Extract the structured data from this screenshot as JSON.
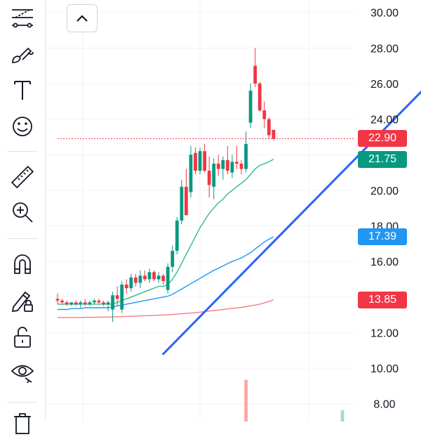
{
  "toolbar": {
    "tools": [
      {
        "icon": "trend-line-tools-icon"
      },
      {
        "icon": "brush-icon"
      },
      {
        "icon": "text-tool-icon"
      },
      {
        "icon": "emoji-icon"
      },
      {
        "icon": "ruler-icon"
      },
      {
        "icon": "zoom-in-icon"
      },
      {
        "icon": "magnet-icon"
      },
      {
        "icon": "lock-drawing-icon"
      },
      {
        "icon": "unlock-icon"
      },
      {
        "icon": "eye-icon"
      },
      {
        "icon": "trash-icon"
      }
    ]
  },
  "chart_data": {
    "type": "candlestick",
    "y_axis": {
      "ticks": [
        "30.00",
        "28.00",
        "26.00",
        "24.00",
        "22.00",
        "20.00",
        "18.00",
        "16.00",
        "14.00",
        "12.00",
        "10.00",
        "8.00"
      ],
      "tick_values": [
        30,
        28,
        26,
        24,
        22,
        20,
        18,
        16,
        14,
        12,
        10,
        8
      ],
      "range": [
        7.0,
        30.7
      ]
    },
    "price_tags": [
      {
        "label": "22.90",
        "value": 22.9,
        "color": "#f23645"
      },
      {
        "label": "21.75",
        "value": 21.75,
        "color": "#089981"
      },
      {
        "label": "17.39",
        "value": 17.39,
        "color": "#2196f3"
      },
      {
        "label": "13.85",
        "value": 13.85,
        "color": "#f23645"
      }
    ],
    "candles": [
      [
        13.9,
        14.2,
        13.6,
        13.8
      ],
      [
        13.8,
        13.9,
        13.6,
        13.7
      ],
      [
        13.7,
        13.8,
        13.5,
        13.6
      ],
      [
        13.6,
        13.7,
        13.5,
        13.7
      ],
      [
        13.7,
        13.8,
        13.5,
        13.6
      ],
      [
        13.6,
        13.8,
        13.4,
        13.7
      ],
      [
        13.7,
        13.9,
        13.5,
        13.6
      ],
      [
        13.6,
        13.8,
        13.5,
        13.7
      ],
      [
        13.7,
        13.9,
        13.6,
        13.8
      ],
      [
        13.8,
        13.9,
        13.6,
        13.7
      ],
      [
        13.7,
        13.8,
        13.5,
        13.6
      ],
      [
        13.6,
        13.8,
        13.2,
        13.7
      ],
      [
        13.3,
        14.3,
        12.6,
        14.1
      ],
      [
        14.1,
        14.6,
        13.5,
        13.9
      ],
      [
        13.3,
        14.9,
        13.1,
        14.7
      ],
      [
        14.7,
        15.0,
        14.2,
        14.5
      ],
      [
        14.5,
        15.3,
        14.3,
        15.1
      ],
      [
        15.1,
        15.3,
        14.6,
        14.8
      ],
      [
        14.8,
        15.5,
        14.5,
        15.2
      ],
      [
        15.2,
        15.5,
        14.9,
        15.0
      ],
      [
        15.0,
        15.6,
        14.8,
        15.4
      ],
      [
        15.4,
        15.5,
        14.9,
        15.0
      ],
      [
        15.0,
        15.4,
        14.8,
        15.2
      ],
      [
        15.2,
        15.3,
        14.7,
        14.9
      ],
      [
        14.4,
        15.9,
        14.2,
        15.7
      ],
      [
        15.7,
        16.9,
        15.4,
        16.6
      ],
      [
        16.6,
        18.5,
        16.4,
        18.3
      ],
      [
        18.3,
        20.6,
        18.1,
        20.2
      ],
      [
        20.2,
        21.2,
        18.6,
        18.6
      ],
      [
        19.9,
        22.5,
        19.6,
        22.0
      ],
      [
        22.1,
        22.4,
        20.9,
        21.1
      ],
      [
        21.1,
        22.4,
        20.9,
        22.2
      ],
      [
        22.2,
        22.6,
        21.0,
        21.1
      ],
      [
        21.1,
        21.9,
        19.6,
        20.3
      ],
      [
        20.2,
        21.8,
        19.5,
        21.5
      ],
      [
        21.5,
        22.0,
        20.8,
        21.2
      ],
      [
        21.2,
        21.9,
        20.6,
        21.7
      ],
      [
        21.7,
        22.5,
        20.9,
        21.1
      ],
      [
        21.0,
        22.0,
        20.7,
        21.6
      ],
      [
        21.6,
        22.5,
        21.2,
        21.5
      ],
      [
        21.5,
        21.7,
        20.9,
        21.2
      ],
      [
        21.2,
        23.3,
        21.0,
        22.6
      ],
      [
        23.8,
        26.0,
        23.5,
        25.6
      ],
      [
        27.0,
        28.0,
        25.8,
        26.0
      ],
      [
        26.0,
        26.1,
        24.4,
        24.5
      ],
      [
        24.5,
        25.0,
        23.5,
        24.0
      ],
      [
        24.0,
        24.1,
        22.9,
        23.1
      ],
      [
        23.4,
        23.4,
        22.8,
        22.9
      ]
    ],
    "ma_series": [
      {
        "color": "#2ebd85",
        "values": [
          13.6,
          13.6,
          13.6,
          13.6,
          13.6,
          13.6,
          13.6,
          13.6,
          13.6,
          13.6,
          13.6,
          13.6,
          13.6,
          13.7,
          13.8,
          13.9,
          14.0,
          14.1,
          14.2,
          14.3,
          14.4,
          14.5,
          14.6,
          14.6,
          14.7,
          15.0,
          15.4,
          15.9,
          16.4,
          16.9,
          17.4,
          17.9,
          18.3,
          18.7,
          19.0,
          19.3,
          19.5,
          19.8,
          20.0,
          20.2,
          20.4,
          20.6,
          20.9,
          21.2,
          21.4,
          21.5,
          21.6,
          21.75
        ]
      },
      {
        "color": "#2196f3",
        "values": [
          13.3,
          13.3,
          13.3,
          13.35,
          13.35,
          13.35,
          13.4,
          13.4,
          13.4,
          13.4,
          13.4,
          13.4,
          13.45,
          13.5,
          13.55,
          13.6,
          13.65,
          13.7,
          13.75,
          13.8,
          13.85,
          13.9,
          13.95,
          14.0,
          14.05,
          14.15,
          14.3,
          14.45,
          14.6,
          14.75,
          14.9,
          15.05,
          15.2,
          15.35,
          15.5,
          15.62,
          15.75,
          15.88,
          16.0,
          16.1,
          16.2,
          16.35,
          16.5,
          16.7,
          16.9,
          17.1,
          17.25,
          17.39
        ]
      },
      {
        "color": "#f77c80",
        "values": [
          12.85,
          12.85,
          12.85,
          12.85,
          12.85,
          12.85,
          12.86,
          12.86,
          12.86,
          12.87,
          12.87,
          12.88,
          12.88,
          12.89,
          12.9,
          12.91,
          12.92,
          12.93,
          12.94,
          12.95,
          12.96,
          12.97,
          12.98,
          12.99,
          13.0,
          13.02,
          13.04,
          13.06,
          13.08,
          13.1,
          13.12,
          13.15,
          13.18,
          13.21,
          13.24,
          13.27,
          13.3,
          13.33,
          13.36,
          13.39,
          13.42,
          13.46,
          13.5,
          13.55,
          13.6,
          13.67,
          13.75,
          13.85
        ]
      }
    ],
    "trend_line": {
      "from": [
        23,
        10.8
      ],
      "to": [
        98,
        30.5
      ]
    },
    "last_price_line": 22.9,
    "volume": [
      {
        "index": 41,
        "color": "#f7a9a7",
        "level": 0.33
      },
      {
        "index": 62,
        "color": "#a4dcc8",
        "level": 0.09
      }
    ]
  }
}
